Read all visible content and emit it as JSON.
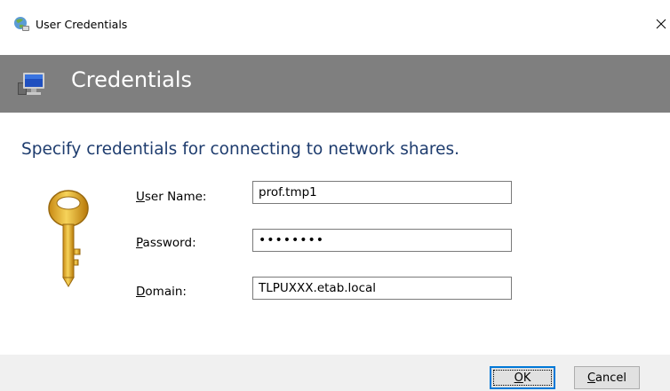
{
  "window": {
    "title": "User Credentials",
    "close_label": "×"
  },
  "banner": {
    "title": "Credentials"
  },
  "instruction": "Specify credentials for connecting to network shares.",
  "form": {
    "username": {
      "label_access_key": "U",
      "label_rest": "ser Name:",
      "value": "prof.tmp1"
    },
    "password": {
      "label_access_key": "P",
      "label_rest": "assword:",
      "value_masked": "••••••••"
    },
    "domain": {
      "label_access_key": "D",
      "label_rest": "omain:",
      "value": "TLPUXXX.etab.local"
    }
  },
  "buttons": {
    "ok": {
      "access_key": "O",
      "rest": "K"
    },
    "cancel": {
      "access_key": "C",
      "rest": "ancel"
    }
  },
  "icons": {
    "app": "credentials-app-icon",
    "banner": "computer-icon",
    "key": "key-icon",
    "close": "close-icon"
  },
  "colors": {
    "banner_bg": "#7f7f7f",
    "instruction_text": "#1e3c6e",
    "footer_bg": "#f0f0f0",
    "default_button_border": "#0078d7"
  }
}
